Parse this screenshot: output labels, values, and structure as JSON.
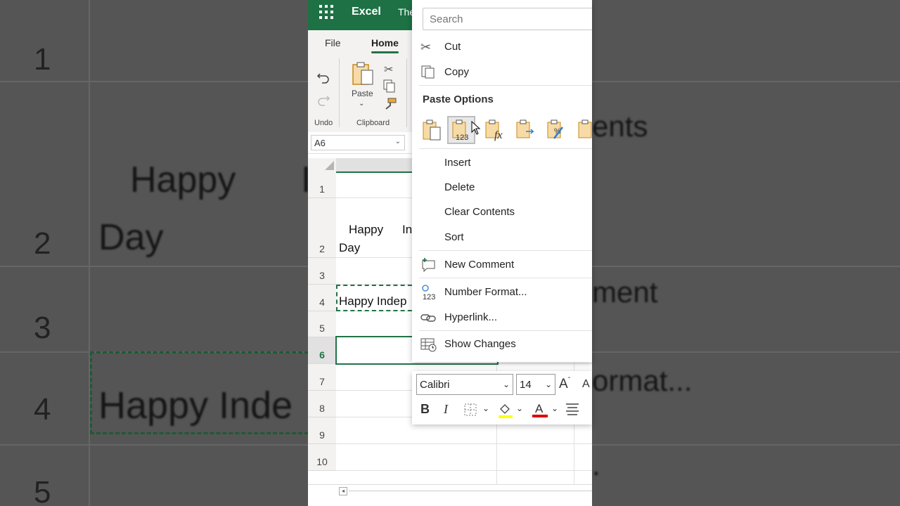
{
  "background": {
    "row_numbers": [
      "1",
      "2",
      "3",
      "4",
      "5"
    ],
    "cell_text": {
      "line1": "Happy",
      "line1b": "I",
      "line2": "Day",
      "row4": "Happy Inde"
    },
    "right_words": [
      "ents",
      "ment",
      "ormat...",
      "."
    ]
  },
  "app": {
    "name": "Excel",
    "doc_title": "The"
  },
  "ribbon": {
    "tabs": [
      "File",
      "Home"
    ],
    "undo_group_label": "Undo",
    "paste_label": "Paste",
    "clipboard_group_label": "Clipboard"
  },
  "formula_bar": {
    "name_box": "A6"
  },
  "sheet": {
    "rows": [
      "1",
      "2",
      "3",
      "4",
      "5",
      "6",
      "7",
      "8",
      "9",
      "10"
    ],
    "selected_row": "6",
    "cells": {
      "r2_line1": "Happy",
      "r2_line1b": "In",
      "r2_line2": "Day",
      "r4": "Happy Indep"
    }
  },
  "context_menu": {
    "search_placeholder": "Search",
    "cut": "Cut",
    "copy": "Copy",
    "paste_options_header": "Paste Options",
    "insert": "Insert",
    "delete": "Delete",
    "clear_contents": "Clear Contents",
    "sort": "Sort",
    "new_comment": "New Comment",
    "number_format": "Number Format...",
    "hyperlink": "Hyperlink...",
    "show_changes": "Show Changes"
  },
  "mini_toolbar": {
    "font": "Calibri",
    "size": "14",
    "bold": "B",
    "italic": "I",
    "grow": "A",
    "shrink": "A"
  },
  "colors": {
    "excel_green": "#1e7145",
    "accent": "#217346",
    "highlight": "#ffff00",
    "font_color": "#e00000"
  }
}
